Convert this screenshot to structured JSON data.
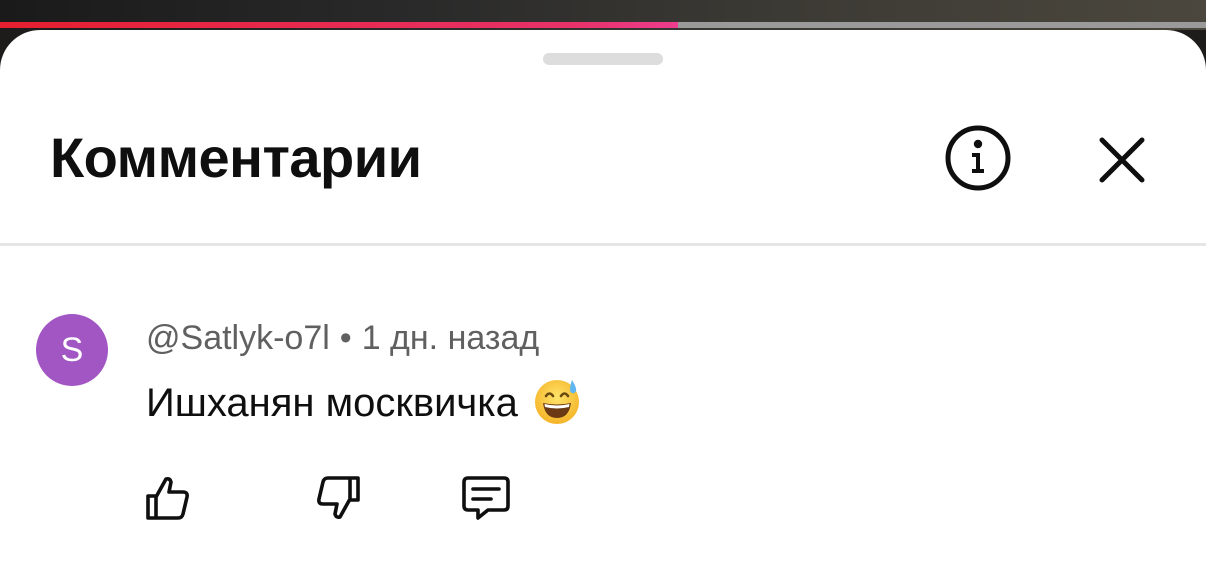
{
  "video": {
    "progress_fraction": 0.562,
    "progress_color": "#e51f2f"
  },
  "sheet": {
    "title": "Комментарии",
    "info_icon": "info-circle-icon",
    "close_icon": "close-icon"
  },
  "comments": [
    {
      "avatar_letter": "S",
      "avatar_color": "#a256c4",
      "author": "@Satlyk-o7l",
      "separator": "•",
      "time": "1 дн. назад",
      "text": "Ишханян москвичка",
      "emoji_icon": "grinning-face-with-sweat-emoji",
      "actions": [
        "thumbs-up-icon",
        "thumbs-down-icon",
        "reply-comment-icon"
      ]
    }
  ]
}
